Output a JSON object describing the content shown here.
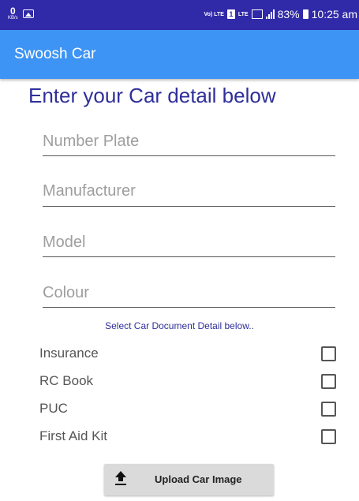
{
  "status_bar": {
    "data_speed": "0",
    "data_unit": "KB/s",
    "volte": "Vo) LTE",
    "sim": "1",
    "lte": "LTE",
    "battery": "83%",
    "time": "10:25 am"
  },
  "app_bar": {
    "title": "Swoosh Car"
  },
  "form": {
    "heading": "Enter your Car detail below",
    "fields": {
      "number_plate": "Number Plate",
      "manufacturer": "Manufacturer",
      "model": "Model",
      "colour": "Colour"
    },
    "documents_heading": "Select Car Document Detail below..",
    "documents": {
      "insurance": "Insurance",
      "rc_book": "RC Book",
      "puc": "PUC",
      "first_aid": "First Aid Kit"
    },
    "upload_label": "Upload Car Image"
  },
  "icons": {
    "status": [
      "image-icon",
      "sim-icon",
      "signal-icon",
      "battery-icon"
    ],
    "upload": "upload-icon"
  },
  "colors": {
    "status_bar": "#3029a8",
    "app_bar": "#3d94f5",
    "heading": "#2f2f9a"
  }
}
